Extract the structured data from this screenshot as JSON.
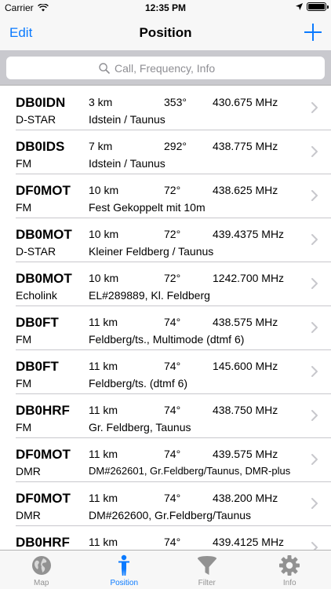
{
  "status": {
    "carrier": "Carrier",
    "time": "12:35 PM",
    "battery_level": 1.0
  },
  "nav": {
    "edit_label": "Edit",
    "title": "Position"
  },
  "search": {
    "placeholder": "Call, Frequency, Info"
  },
  "colors": {
    "accent": "#0a7aff",
    "separator": "#c8c7cc",
    "search_bar": "#c9c9ce",
    "inactive_tab": "#929292"
  },
  "repeaters": [
    {
      "call": "DB0IDN",
      "distance": "3 km",
      "bearing": "353°",
      "frequency": "430.675 MHz",
      "mode": "D-STAR",
      "info": "Idstein / Taunus"
    },
    {
      "call": "DB0IDS",
      "distance": "7 km",
      "bearing": "292°",
      "frequency": "438.775 MHz",
      "mode": "FM",
      "info": "Idstein / Taunus"
    },
    {
      "call": "DF0MOT",
      "distance": "10 km",
      "bearing": "72°",
      "frequency": "438.625 MHz",
      "mode": "FM",
      "info": "Fest Gekoppelt mit 10m"
    },
    {
      "call": "DB0MOT",
      "distance": "10 km",
      "bearing": "72°",
      "frequency": "439.4375 MHz",
      "mode": "D-STAR",
      "info": "Kleiner Feldberg / Taunus"
    },
    {
      "call": "DB0MOT",
      "distance": "10 km",
      "bearing": "72°",
      "frequency": "1242.700 MHz",
      "mode": "Echolink",
      "info": "EL#289889, Kl. Feldberg"
    },
    {
      "call": "DB0FT",
      "distance": "11 km",
      "bearing": "74°",
      "frequency": "438.575 MHz",
      "mode": "FM",
      "info": "Feldberg/ts., Multimode (dtmf 6)"
    },
    {
      "call": "DB0FT",
      "distance": "11 km",
      "bearing": "74°",
      "frequency": "145.600 MHz",
      "mode": "FM",
      "info": "Feldberg/ts. (dtmf 6)"
    },
    {
      "call": "DB0HRF",
      "distance": "11 km",
      "bearing": "74°",
      "frequency": "438.750 MHz",
      "mode": "FM",
      "info": "Gr. Feldberg, Taunus"
    },
    {
      "call": "DF0MOT",
      "distance": "11 km",
      "bearing": "74°",
      "frequency": "439.575 MHz",
      "mode": "DMR",
      "info": "DM#262601, Gr.Feldberg/Taunus, DMR-plus"
    },
    {
      "call": "DF0MOT",
      "distance": "11 km",
      "bearing": "74°",
      "frequency": "438.200 MHz",
      "mode": "DMR",
      "info": "DM#262600, Gr.Feldberg/Taunus"
    },
    {
      "call": "DB0HRF",
      "distance": "11 km",
      "bearing": "74°",
      "frequency": "439.4125 MHz",
      "mode": "",
      "info": ""
    }
  ],
  "tabs": [
    {
      "label": "Map",
      "icon": "globe-icon"
    },
    {
      "label": "Position",
      "icon": "person-icon"
    },
    {
      "label": "Filter",
      "icon": "funnel-icon"
    },
    {
      "label": "Info",
      "icon": "gear-icon"
    }
  ]
}
